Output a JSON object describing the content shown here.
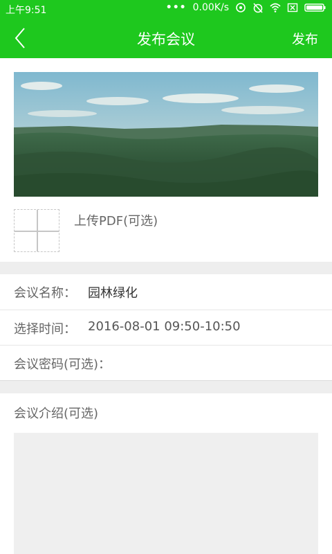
{
  "status_bar": {
    "time": "上午9:51",
    "dots": "•••",
    "net_speed": "0.00K/s",
    "icons": [
      "sync-icon",
      "alarm-off-icon",
      "wifi-icon",
      "sim-x-icon",
      "battery-icon"
    ]
  },
  "nav": {
    "back_icon": "back-chevron-icon",
    "title": "发布会议",
    "publish_label": "发布"
  },
  "cover": {
    "image": "forest-landscape-photo"
  },
  "upload": {
    "label": "上传PDF(可选)"
  },
  "form": {
    "name_label": "会议名称：",
    "name_value": "园林绿化",
    "time_label": "选择时间：",
    "time_value": "2016-08-01 09:50-10:50",
    "password_label": "会议密码(可选)："
  },
  "intro": {
    "label": "会议介绍(可选)",
    "value": ""
  },
  "colors": {
    "accent": "#1ec81e",
    "label_gray": "#666666",
    "value_dark": "#333333",
    "value_gray": "#555555",
    "divider_bg": "#eeeeee"
  }
}
